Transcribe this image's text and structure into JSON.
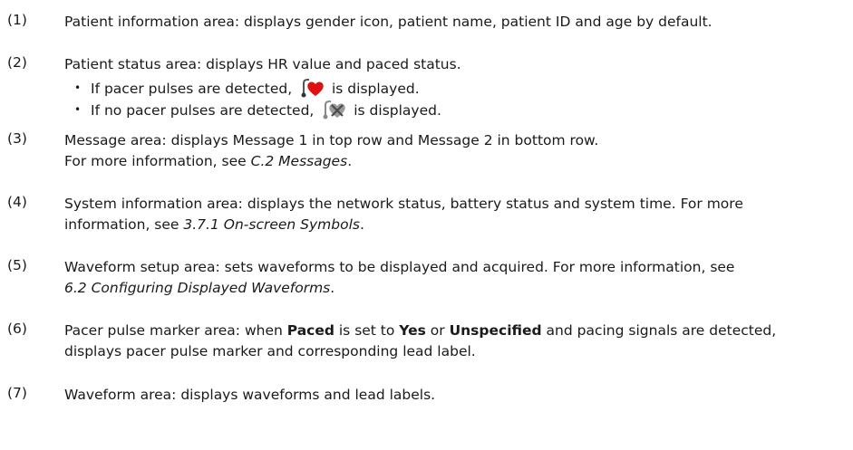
{
  "items": [
    {
      "num": "(1)",
      "text": "Patient information area: displays gender icon, patient name, patient ID and age by default."
    },
    {
      "num": "(2)",
      "text": "Patient status area: displays HR value and paced status.",
      "bullets": [
        {
          "pre": "If pacer pulses are detected,",
          "icon": "paced-heart-icon",
          "post": "is displayed."
        },
        {
          "pre": "If no pacer pulses are detected,",
          "icon": "not-paced-heart-icon",
          "post": "is displayed."
        }
      ]
    },
    {
      "num": "(3)",
      "line1": "Message area: displays Message 1 in top row and Message 2 in bottom row.",
      "line2_pre": "For more information, see ",
      "line2_ref": "C.2 Messages",
      "line2_post": "."
    },
    {
      "num": "(4)",
      "line1": "System information area: displays the network status, battery status and system time. For more",
      "line2_pre": "information, see ",
      "line2_ref": "3.7.1 On-screen Symbols",
      "line2_post": "."
    },
    {
      "num": "(5)",
      "line1": "Waveform setup area: sets waveforms to be displayed and acquired. For more information, see",
      "line2_ref": "6.2 Configuring Displayed Waveforms",
      "line2_post": "."
    },
    {
      "num": "(6)",
      "l1_a": "Pacer pulse marker area: when ",
      "l1_b1": "Paced",
      "l1_c": " is set to ",
      "l1_b2": "Yes",
      "l1_d": " or ",
      "l1_b3": "Unspecified",
      "l1_e": " and pacing signals are detected,",
      "line2": "displays pacer pulse marker and corresponding lead label."
    },
    {
      "num": "(7)",
      "text": "Waveform area: displays waveforms and lead labels."
    }
  ],
  "colors": {
    "heart_red": "#e01010",
    "icon_gray": "#8a8a8a"
  }
}
